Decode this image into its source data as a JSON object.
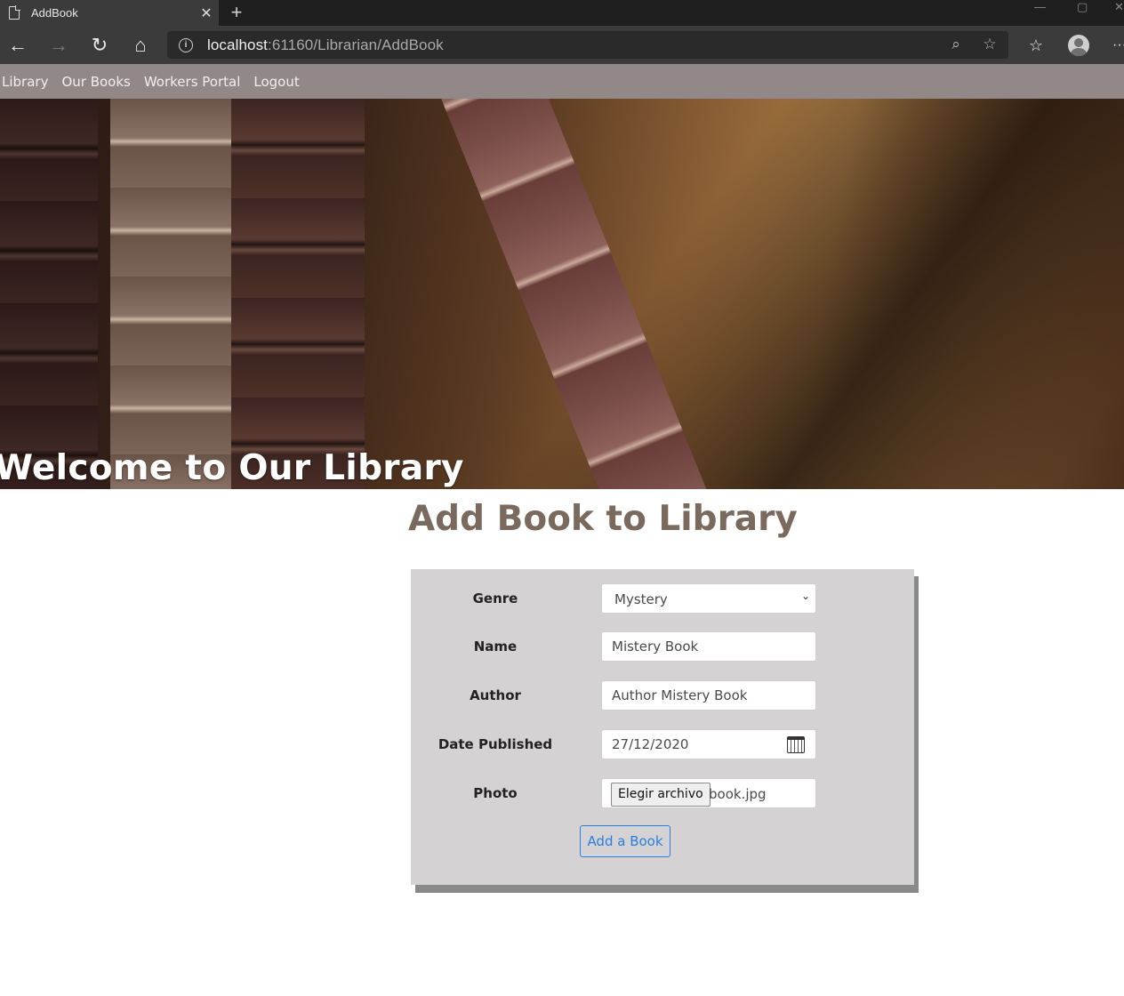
{
  "browser": {
    "tab_title": "AddBook",
    "url_host": "localhost",
    "url_path": ":61160/Librarian/AddBook"
  },
  "nav": {
    "items": [
      "Library",
      "Our Books",
      "Workers Portal",
      "Logout"
    ]
  },
  "hero": {
    "title": "Welcome to Our Library"
  },
  "page": {
    "title": "Add Book to Library"
  },
  "form": {
    "genre_label": "Genre",
    "genre_value": "Mystery",
    "name_label": "Name",
    "name_value": "Mistery Book",
    "author_label": "Author",
    "author_value": "Author Mistery Book",
    "date_label": "Date Published",
    "date_value": "27/12/2020",
    "photo_label": "Photo",
    "photo_button": "Elegir archivo",
    "photo_file": "book.jpg",
    "submit_label": "Add a Book"
  },
  "colors": {
    "nav_bg": "#928888",
    "title_color": "#7a6a5e",
    "card_bg": "#d4d2d2",
    "accent": "#2b7de1"
  }
}
